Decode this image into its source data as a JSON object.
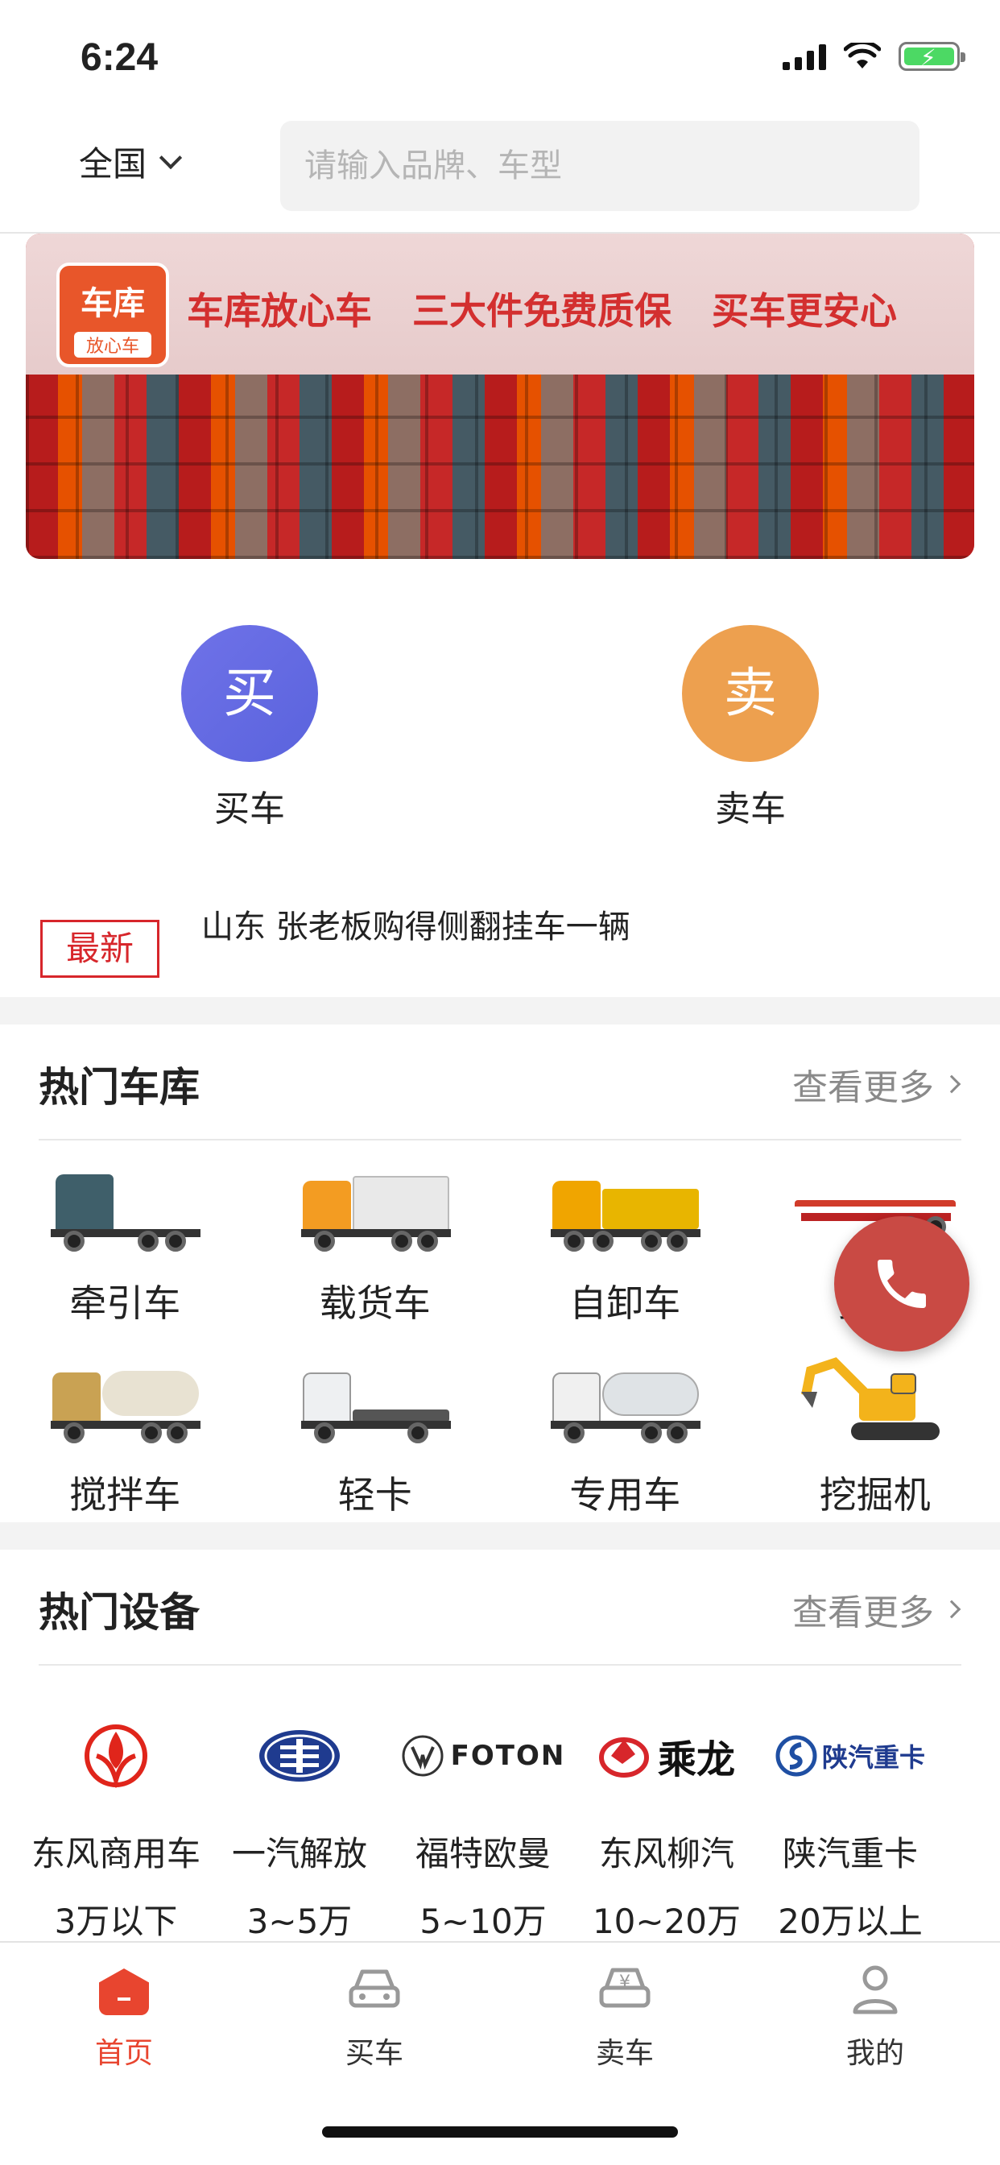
{
  "status_bar": {
    "time": "6:24"
  },
  "header": {
    "region": "全国",
    "search_placeholder": "请输入品牌、车型"
  },
  "banner": {
    "logo_main": "车库",
    "logo_sub": "放心车",
    "slogans": [
      "车库放心车",
      "三大件免费质保",
      "买车更安心"
    ]
  },
  "actions": [
    {
      "icon_char": "买",
      "label": "买车",
      "color": "#6166e2"
    },
    {
      "icon_char": "卖",
      "label": "卖车",
      "color": "#eda04f"
    }
  ],
  "latest": {
    "badge": "最新",
    "text": "山东 张老板购得侧翻挂车一辆"
  },
  "hot_vehicles": {
    "title": "热门车库",
    "more": "查看更多",
    "items": [
      {
        "label": "牵引车",
        "icon": "tractor-truck-icon"
      },
      {
        "label": "载货车",
        "icon": "cargo-truck-icon"
      },
      {
        "label": "自卸车",
        "icon": "dump-truck-icon"
      },
      {
        "label": "挂车",
        "icon": "trailer-icon"
      },
      {
        "label": "搅拌车",
        "icon": "mixer-truck-icon"
      },
      {
        "label": "轻卡",
        "icon": "light-truck-icon"
      },
      {
        "label": "专用车",
        "icon": "special-vehicle-icon"
      },
      {
        "label": "挖掘机",
        "icon": "excavator-icon"
      }
    ]
  },
  "hot_equipment": {
    "title": "热门设备",
    "more": "查看更多",
    "brands": [
      {
        "name": "东风商用车",
        "logo_text": "",
        "icon": "dongfeng-logo-icon"
      },
      {
        "name": "一汽解放",
        "logo_text": "",
        "icon": "faw-logo-icon"
      },
      {
        "name": "福特欧曼",
        "logo_text": "FOTON",
        "icon": "foton-logo-icon"
      },
      {
        "name": "东风柳汽",
        "logo_text": "乘龙",
        "icon": "chenglong-logo-icon"
      },
      {
        "name": "陕汽重卡",
        "logo_text": "陕汽重卡",
        "icon": "shacman-logo-icon"
      }
    ],
    "price_ranges": [
      "3万以下",
      "3~5万",
      "5~10万",
      "10~20万",
      "20万以上"
    ]
  },
  "tabbar": [
    {
      "label": "首页",
      "icon": "home-icon",
      "active": true
    },
    {
      "label": "买车",
      "icon": "car-icon",
      "active": false
    },
    {
      "label": "卖车",
      "icon": "sell-car-icon",
      "active": false
    },
    {
      "label": "我的",
      "icon": "user-icon",
      "active": false
    }
  ],
  "colors": {
    "accent": "#e8452f",
    "buy": "#6166e2",
    "sell": "#eda04f",
    "phone": "#c94a44"
  }
}
